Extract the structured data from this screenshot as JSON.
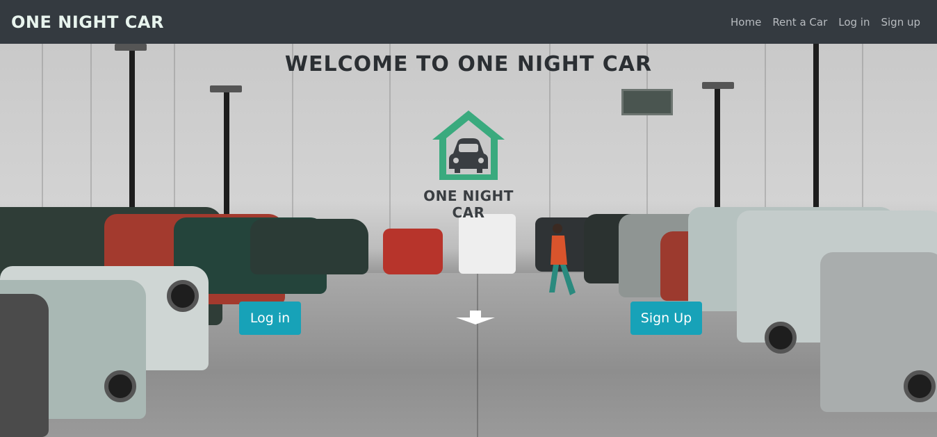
{
  "navbar": {
    "brand": "ONE NIGHT CAR",
    "links": [
      {
        "label": "Home"
      },
      {
        "label": "Rent a Car"
      },
      {
        "label": "Log in"
      },
      {
        "label": "Sign up"
      }
    ]
  },
  "hero": {
    "title": "WELCOME TO ONE NIGHT CAR",
    "logo_text": "ONE NIGHT CAR",
    "login_button": "Log in",
    "signup_button": "Sign Up",
    "icons": [
      "house-car-logo-icon",
      "arrow-down-icon"
    ]
  },
  "colors": {
    "navbar_bg": "#343a40",
    "brand_text": "#e8f4ee",
    "nav_link": "#b8bcc0",
    "button_bg": "#17a2b8",
    "logo_green": "#3aaa7e",
    "logo_dark": "#3a3e42"
  }
}
